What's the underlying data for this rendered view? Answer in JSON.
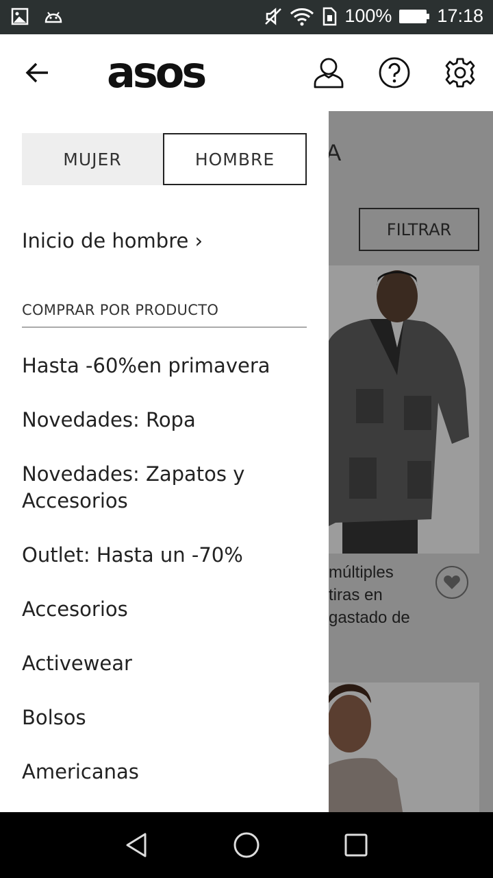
{
  "status": {
    "battery": "100%",
    "time": "17:18"
  },
  "header": {
    "logo": "asos"
  },
  "drawer": {
    "tabs": [
      {
        "label": "MUJER",
        "active": false
      },
      {
        "label": "HOMBRE",
        "active": true
      }
    ],
    "home_link": "Inicio de hombre ›",
    "section_title": "COMPRAR POR PRODUCTO",
    "items": [
      "Hasta -60%en primavera",
      "Novedades: Ropa",
      "Novedades: Zapatos y Accesorios",
      "Outlet: Hasta un -70%",
      "Accesorios",
      "Activewear",
      "Bolsos",
      "Americanas"
    ]
  },
  "background": {
    "title_fragment": "IA",
    "filter_label": "FILTRAR",
    "product_desc_lines": [
      "múltiples",
      "tiras en",
      "gastado de"
    ]
  },
  "colors": {
    "statusbar": "#2b3131",
    "overlay": "#8a8a8a",
    "navbar": "#000000"
  },
  "icons": {
    "back": "arrow-left-icon",
    "account": "user-icon",
    "help": "question-circle-icon",
    "settings": "gear-icon"
  }
}
